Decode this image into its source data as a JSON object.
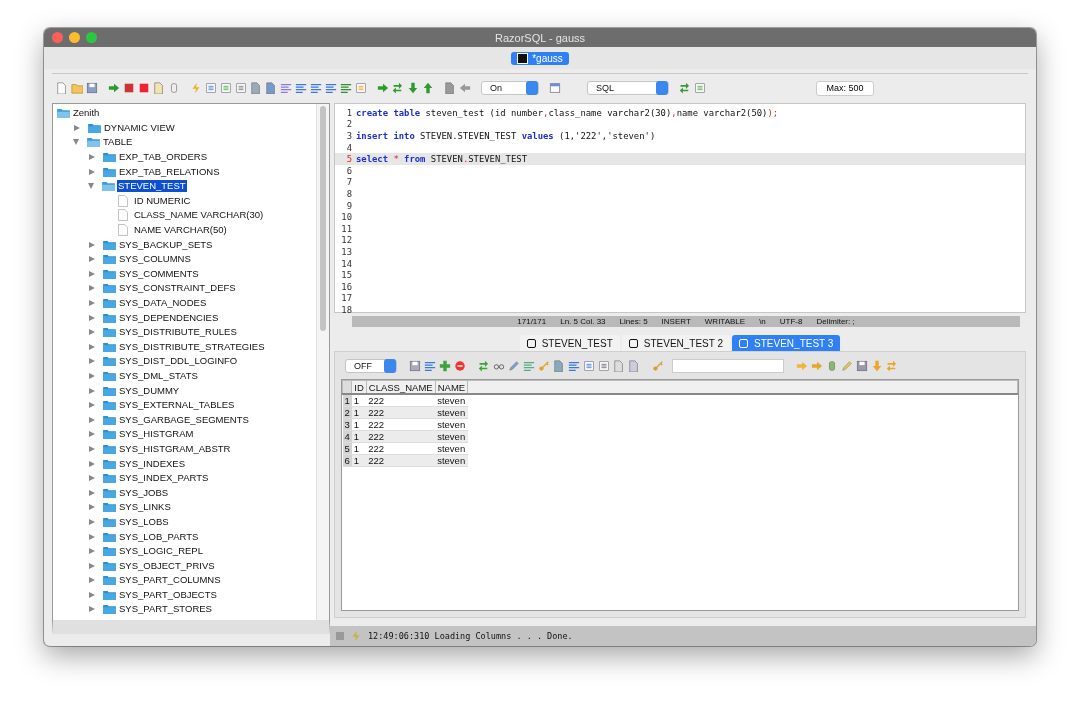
{
  "window": {
    "title": "RazorSQL - gauss"
  },
  "document_tabs": [
    {
      "label": "*gauss",
      "selected": true
    }
  ],
  "toolbar": {
    "autocommit_select": "On",
    "language_select": "SQL",
    "max_rows_button": "Max: 500"
  },
  "tree": {
    "label": "Zenith",
    "kind": "root",
    "children": [
      {
        "label": "DYNAMIC VIEW",
        "kind": "folder",
        "expanded": false,
        "selected": false
      },
      {
        "label": "TABLE",
        "kind": "folder",
        "expanded": true,
        "selected": false,
        "children": [
          {
            "label": "EXP_TAB_ORDERS",
            "kind": "folder",
            "expanded": false,
            "selected": false
          },
          {
            "label": "EXP_TAB_RELATIONS",
            "kind": "folder",
            "expanded": false,
            "selected": false
          },
          {
            "label": "STEVEN_TEST",
            "kind": "folder",
            "expanded": true,
            "selected": true,
            "children": [
              {
                "label": "ID NUMERIC",
                "kind": "column",
                "selected": false
              },
              {
                "label": "CLASS_NAME VARCHAR(30)",
                "kind": "column",
                "selected": false
              },
              {
                "label": "NAME VARCHAR(50)",
                "kind": "column",
                "selected": false
              }
            ]
          },
          {
            "label": "SYS_BACKUP_SETS",
            "kind": "folder",
            "expanded": false,
            "selected": false
          },
          {
            "label": "SYS_COLUMNS",
            "kind": "folder",
            "expanded": false,
            "selected": false
          },
          {
            "label": "SYS_COMMENTS",
            "kind": "folder",
            "expanded": false,
            "selected": false
          },
          {
            "label": "SYS_CONSTRAINT_DEFS",
            "kind": "folder",
            "expanded": false,
            "selected": false
          },
          {
            "label": "SYS_DATA_NODES",
            "kind": "folder",
            "expanded": false,
            "selected": false
          },
          {
            "label": "SYS_DEPENDENCIES",
            "kind": "folder",
            "expanded": false,
            "selected": false
          },
          {
            "label": "SYS_DISTRIBUTE_RULES",
            "kind": "folder",
            "expanded": false,
            "selected": false
          },
          {
            "label": "SYS_DISTRIBUTE_STRATEGIES",
            "kind": "folder",
            "expanded": false,
            "selected": false
          },
          {
            "label": "SYS_DIST_DDL_LOGINFO",
            "kind": "folder",
            "expanded": false,
            "selected": false
          },
          {
            "label": "SYS_DML_STATS",
            "kind": "folder",
            "expanded": false,
            "selected": false
          },
          {
            "label": "SYS_DUMMY",
            "kind": "folder",
            "expanded": false,
            "selected": false
          },
          {
            "label": "SYS_EXTERNAL_TABLES",
            "kind": "folder",
            "expanded": false,
            "selected": false
          },
          {
            "label": "SYS_GARBAGE_SEGMENTS",
            "kind": "folder",
            "expanded": false,
            "selected": false
          },
          {
            "label": "SYS_HISTGRAM",
            "kind": "folder",
            "expanded": false,
            "selected": false
          },
          {
            "label": "SYS_HISTGRAM_ABSTR",
            "kind": "folder",
            "expanded": false,
            "selected": false
          },
          {
            "label": "SYS_INDEXES",
            "kind": "folder",
            "expanded": false,
            "selected": false
          },
          {
            "label": "SYS_INDEX_PARTS",
            "kind": "folder",
            "expanded": false,
            "selected": false
          },
          {
            "label": "SYS_JOBS",
            "kind": "folder",
            "expanded": false,
            "selected": false
          },
          {
            "label": "SYS_LINKS",
            "kind": "folder",
            "expanded": false,
            "selected": false
          },
          {
            "label": "SYS_LOBS",
            "kind": "folder",
            "expanded": false,
            "selected": false
          },
          {
            "label": "SYS_LOB_PARTS",
            "kind": "folder",
            "expanded": false,
            "selected": false
          },
          {
            "label": "SYS_LOGIC_REPL",
            "kind": "folder",
            "expanded": false,
            "selected": false
          },
          {
            "label": "SYS_OBJECT_PRIVS",
            "kind": "folder",
            "expanded": false,
            "selected": false
          },
          {
            "label": "SYS_PART_COLUMNS",
            "kind": "folder",
            "expanded": false,
            "selected": false
          },
          {
            "label": "SYS_PART_OBJECTS",
            "kind": "folder",
            "expanded": false,
            "selected": false
          },
          {
            "label": "SYS_PART_STORES",
            "kind": "folder",
            "expanded": false,
            "selected": false
          }
        ]
      }
    ]
  },
  "editor": {
    "lines": [
      {
        "number": "1",
        "current": false,
        "tokens": [
          {
            "kind": "keyword",
            "text": "create "
          },
          {
            "kind": "keyword",
            "text": "table"
          },
          {
            "kind": "plain",
            "text": " steven_test (id number"
          },
          {
            "kind": "symbol",
            "text": ","
          },
          {
            "kind": "plain",
            "text": "class_name varchar2(30)"
          },
          {
            "kind": "symbol",
            "text": ","
          },
          {
            "kind": "plain",
            "text": "name varchar2(50)"
          },
          {
            "kind": "symbol",
            "text": ");"
          }
        ]
      },
      {
        "number": "2",
        "current": false
      },
      {
        "number": "3",
        "current": false,
        "tokens": [
          {
            "kind": "keyword",
            "text": "insert "
          },
          {
            "kind": "keyword",
            "text": "into"
          },
          {
            "kind": "plain",
            "text": " STEVEN.STEVEN_TEST "
          },
          {
            "kind": "keyword",
            "text": "values"
          },
          {
            "kind": "plain",
            "text": " (1,'222','steven')"
          }
        ]
      },
      {
        "number": "4",
        "current": false
      },
      {
        "number": "5",
        "current": true,
        "tokens": [
          {
            "kind": "keyword",
            "text": "select "
          },
          {
            "kind": "symbol",
            "text": "* "
          },
          {
            "kind": "keyword",
            "text": "from"
          },
          {
            "kind": "plain",
            "text": " STEVEN"
          },
          {
            "kind": "symbol",
            "text": "."
          },
          {
            "kind": "plain",
            "text": "STEVEN_TEST"
          }
        ]
      },
      {
        "number": "6",
        "current": false
      },
      {
        "number": "7",
        "current": false
      },
      {
        "number": "8",
        "current": false
      },
      {
        "number": "9",
        "current": false
      },
      {
        "number": "10",
        "current": false
      },
      {
        "number": "11",
        "current": false
      },
      {
        "number": "12",
        "current": false
      },
      {
        "number": "13",
        "current": false
      },
      {
        "number": "14",
        "current": false
      },
      {
        "number": "15",
        "current": false
      },
      {
        "number": "16",
        "current": false
      },
      {
        "number": "17",
        "current": false
      },
      {
        "number": "18",
        "current": false
      }
    ],
    "status": [
      "171/171",
      "Ln. 5 Col. 33",
      "Lines: 5",
      "INSERT",
      "WRITABLE",
      "\\n",
      "UTF-8",
      "Delimiter: ;"
    ]
  },
  "result_tabs": [
    {
      "label": "STEVEN_TEST",
      "selected": false
    },
    {
      "label": "STEVEN_TEST 2",
      "selected": false
    },
    {
      "label": "STEVEN_TEST 3",
      "selected": true
    }
  ],
  "results_toolbar": {
    "autocommit_select": "OFF"
  },
  "results_grid": {
    "columns": [
      "ID",
      "CLASS_NAME",
      "NAME"
    ],
    "rows": [
      {
        "number": "1",
        "cells": [
          "1",
          "222",
          "steven"
        ]
      },
      {
        "number": "2",
        "cells": [
          "1",
          "222",
          "steven"
        ]
      },
      {
        "number": "3",
        "cells": [
          "1",
          "222",
          "steven"
        ]
      },
      {
        "number": "4",
        "cells": [
          "1",
          "222",
          "steven"
        ]
      },
      {
        "number": "5",
        "cells": [
          "1",
          "222",
          "steven"
        ]
      },
      {
        "number": "6",
        "cells": [
          "1",
          "222",
          "steven"
        ]
      }
    ]
  },
  "status_bar": {
    "message": "12:49:06:310 Loading Columns . . . Done."
  }
}
